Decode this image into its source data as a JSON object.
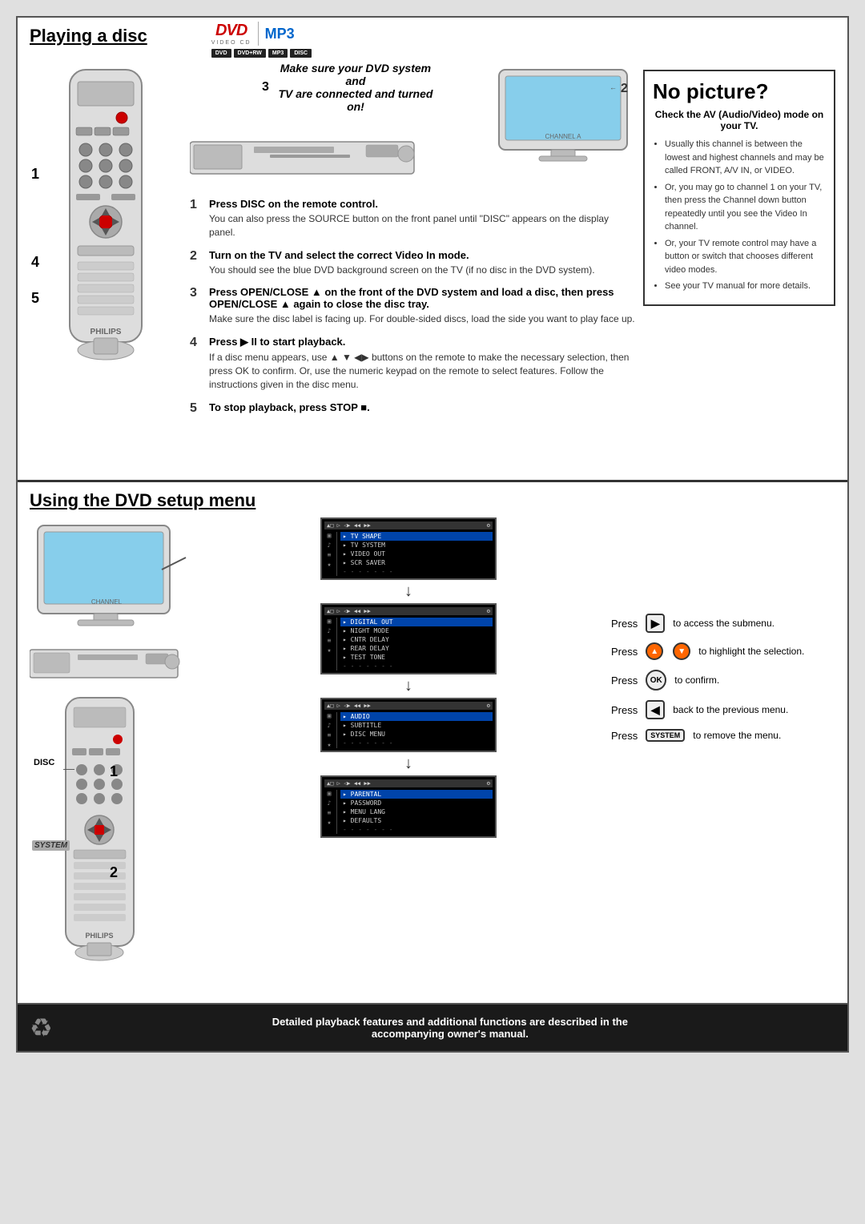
{
  "page": {
    "top_section_title": "Playing a disc",
    "bottom_section_title": "Using the DVD setup menu",
    "footer_line1": "Detailed playback features and additional functions are described in the",
    "footer_line2": "accompanying owner's manual."
  },
  "top": {
    "connected_notice_line1": "Make sure your DVD system and",
    "connected_notice_line2": "TV are connected and turned on!",
    "step1_header": "Press DISC on the remote control.",
    "step1_body": "You can also press the SOURCE button on the front panel until \"DISC\" appears on the display panel.",
    "step2_header": "Turn on the TV and select the correct Video In mode.",
    "step2_body": "You should see the blue DVD background screen on the TV (if no disc in the DVD system).",
    "step3_header": "Press OPEN/CLOSE ▲ on the front of the DVD system and load a disc, then press OPEN/CLOSE ▲ again to close the disc tray.",
    "step3_body": "Make sure the disc label is facing up.  For double-sided discs, load the side you want to play face up.",
    "step4_header": "Press ▶ II  to start playback.",
    "step4_body": "If a disc menu appears, use ▲ ▼ ◀▶ buttons on the remote to make the necessary selection, then press OK to confirm. Or, use the numeric keypad on the remote to select features. Follow the instructions given in the disc menu.",
    "step5_header": "To stop playback, press STOP ■.",
    "no_picture_title": "No picture?",
    "no_picture_subtitle": "Check the AV (Audio/Video) mode on your TV.",
    "no_picture_items": [
      "Usually this channel is between the lowest and highest channels and may be called FRONT, A/V IN, or VIDEO.",
      "Or, you may go to channel 1 on your TV, then press the Channel down button repeatedly until you see the Video In channel.",
      "Or, your TV remote control may have a button or switch that chooses different video modes.",
      "See your TV manual for more details."
    ],
    "disc_logos": [
      "DVD",
      "VIDEO CD",
      "MP3"
    ],
    "disc_types": [
      "DVD",
      "DVD+RW",
      "MP3",
      "DISC"
    ]
  },
  "bottom": {
    "disc_label": "DISC",
    "system_label": "SYSTEM",
    "num1": "1",
    "num2": "2",
    "menu_screens": [
      {
        "id": "screen1",
        "items": [
          "TV SHAPE",
          "TV SYSTEM",
          "VIDEO OUT",
          "SCR SAVER"
        ]
      },
      {
        "id": "screen2",
        "items": [
          "DIGITAL OUT",
          "NIGHT MODE",
          "CNTR DELAY",
          "REAR DELAY",
          "TEST TONE"
        ]
      },
      {
        "id": "screen3",
        "items": [
          "AUDIO",
          "SUBTITLE",
          "DISC MENU"
        ]
      },
      {
        "id": "screen4",
        "items": [
          "PARENTAL",
          "PASSWORD",
          "MENU LANG",
          "DEFAULTS"
        ]
      }
    ],
    "press_instructions": [
      {
        "btn_symbol": "▶",
        "btn_label": "right-arrow-btn",
        "text": "to access the submenu."
      },
      {
        "btn_symbol": "▲▼",
        "btn_label": "up-down-btn",
        "text": "to highlight the selection."
      },
      {
        "btn_symbol": "OK",
        "btn_label": "ok-btn",
        "text": "to confirm."
      },
      {
        "btn_symbol": "◀",
        "btn_label": "back-btn",
        "text": "back to the previous menu."
      },
      {
        "btn_symbol": "SYSTEM",
        "btn_label": "system-btn",
        "text": "to remove the menu."
      }
    ],
    "press_word": "Press"
  }
}
